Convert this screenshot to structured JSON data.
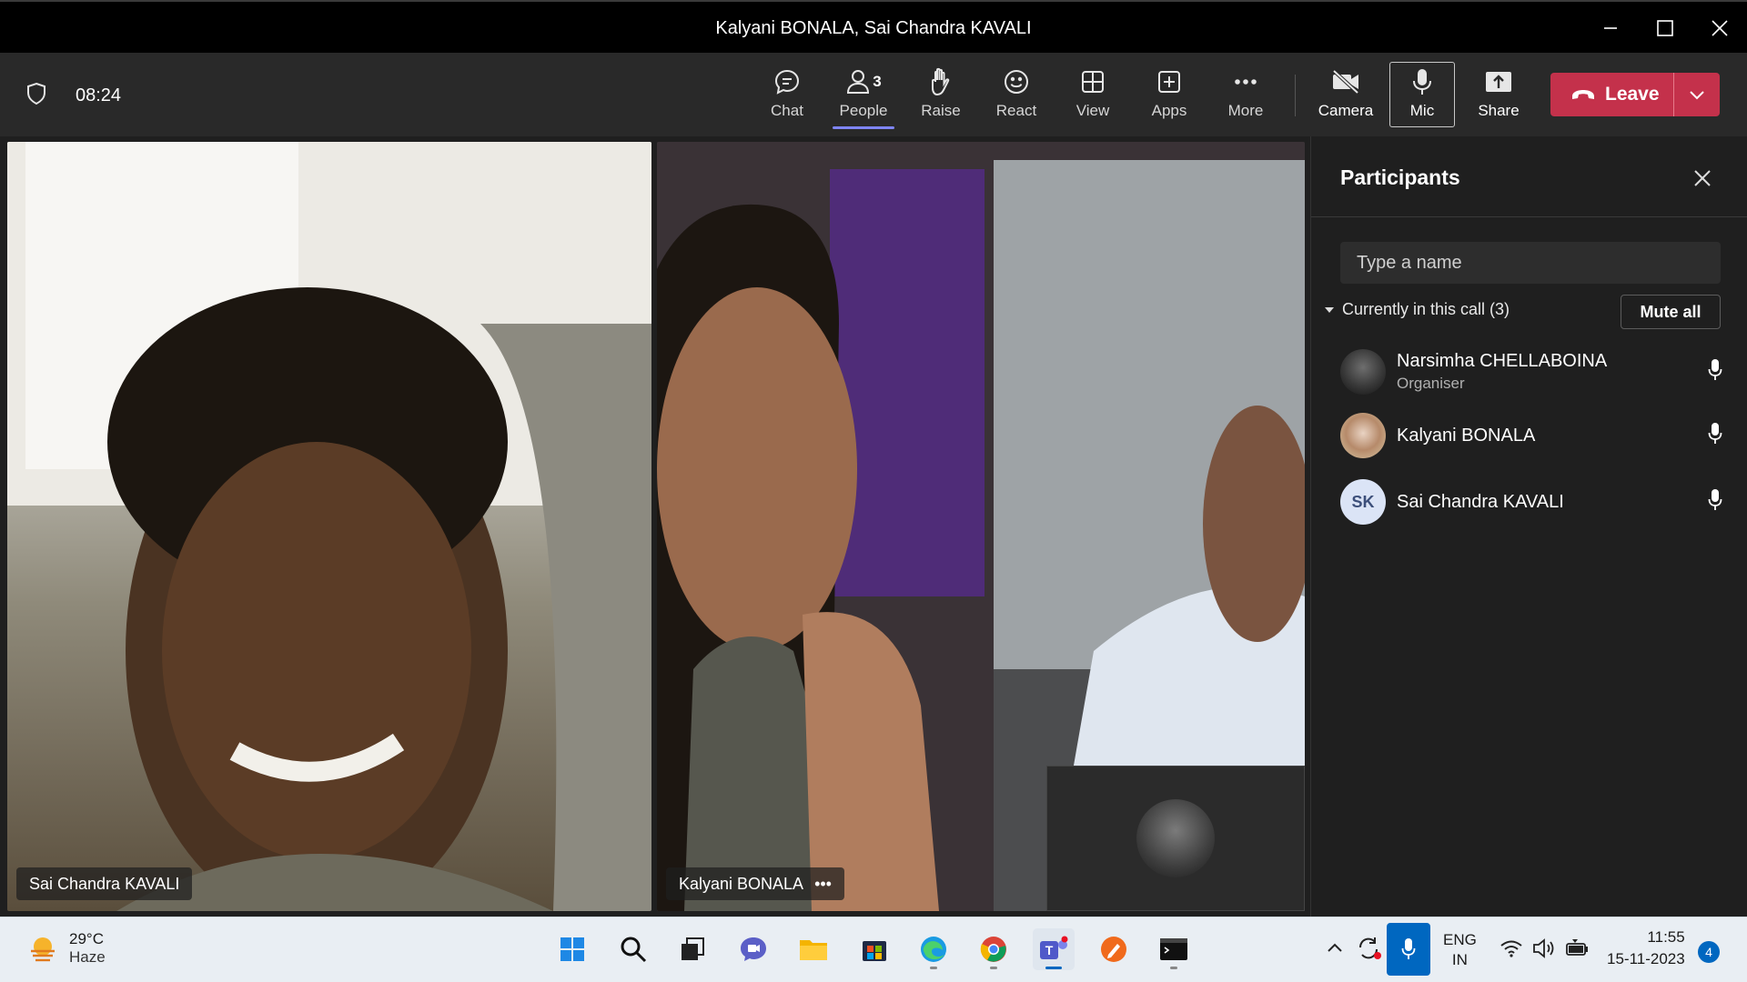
{
  "window": {
    "title": "Kalyani BONALA, Sai Chandra KAVALI"
  },
  "toolbar": {
    "timer": "08:24",
    "items": [
      {
        "label": "Chat",
        "icon": "chat-icon"
      },
      {
        "label": "People",
        "icon": "people-icon",
        "count": "3",
        "active": true
      },
      {
        "label": "Raise",
        "icon": "hand-icon"
      },
      {
        "label": "React",
        "icon": "smiley-icon"
      },
      {
        "label": "View",
        "icon": "grid-icon"
      },
      {
        "label": "Apps",
        "icon": "plus-square-icon"
      },
      {
        "label": "More",
        "icon": "more-icon"
      },
      {
        "label": "Camera",
        "icon": "camera-off-icon"
      },
      {
        "label": "Mic",
        "icon": "mic-icon"
      },
      {
        "label": "Share",
        "icon": "share-icon"
      }
    ],
    "leave_label": "Leave",
    "leave_color": "#c4314b"
  },
  "videos": [
    {
      "name": "Sai Chandra KAVALI"
    },
    {
      "name": "Kalyani BONALA"
    }
  ],
  "panel": {
    "title": "Participants",
    "search_placeholder": "Type a name",
    "section_label": "Currently in this call (3)",
    "mute_all_label": "Mute all",
    "participants": [
      {
        "name": "Narsimha CHELLABOINA",
        "role": "Organiser",
        "initials": ""
      },
      {
        "name": "Kalyani BONALA",
        "role": "",
        "initials": ""
      },
      {
        "name": "Sai Chandra KAVALI",
        "role": "",
        "initials": "SK"
      }
    ]
  },
  "taskbar": {
    "weather_temp": "29°C",
    "weather_desc": "Haze",
    "language_top": "ENG",
    "language_bottom": "IN",
    "time": "11:55",
    "date": "15-11-2023",
    "notification_count": "4",
    "apps": [
      "windows-start-icon",
      "search-icon",
      "task-view-icon",
      "meet-icon",
      "file-explorer-icon",
      "store-icon",
      "edge-icon",
      "chrome-icon",
      "teams-icon",
      "pen-app-icon",
      "terminal-icon"
    ]
  },
  "colors": {
    "accent": "#7f85f5",
    "leave": "#c4314b",
    "taskbar_blue": "#0067c0"
  }
}
